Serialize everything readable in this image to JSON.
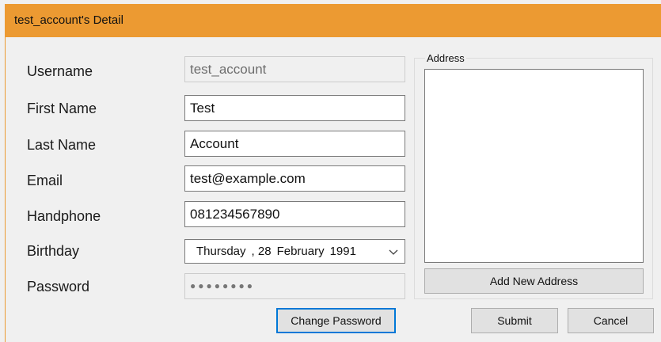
{
  "window": {
    "title": "test_account's Detail",
    "accent_color": "#ec9a32"
  },
  "form": {
    "username": {
      "label": "Username",
      "value": "test_account"
    },
    "first_name": {
      "label": "First Name",
      "value": "Test"
    },
    "last_name": {
      "label": "Last Name",
      "value": "Account"
    },
    "email": {
      "label": "Email",
      "value": "test@example.com"
    },
    "handphone": {
      "label": "Handphone",
      "value": "081234567890"
    },
    "birthday": {
      "label": "Birthday",
      "weekday": "Thursday",
      "day": ", 28",
      "month": "February",
      "year": "1991"
    },
    "password": {
      "label": "Password",
      "value": "●●●●●●●●"
    }
  },
  "address": {
    "group_label": "Address",
    "items": [],
    "add_button": "Add New Address"
  },
  "buttons": {
    "change_password": "Change Password",
    "submit": "Submit",
    "cancel": "Cancel"
  }
}
